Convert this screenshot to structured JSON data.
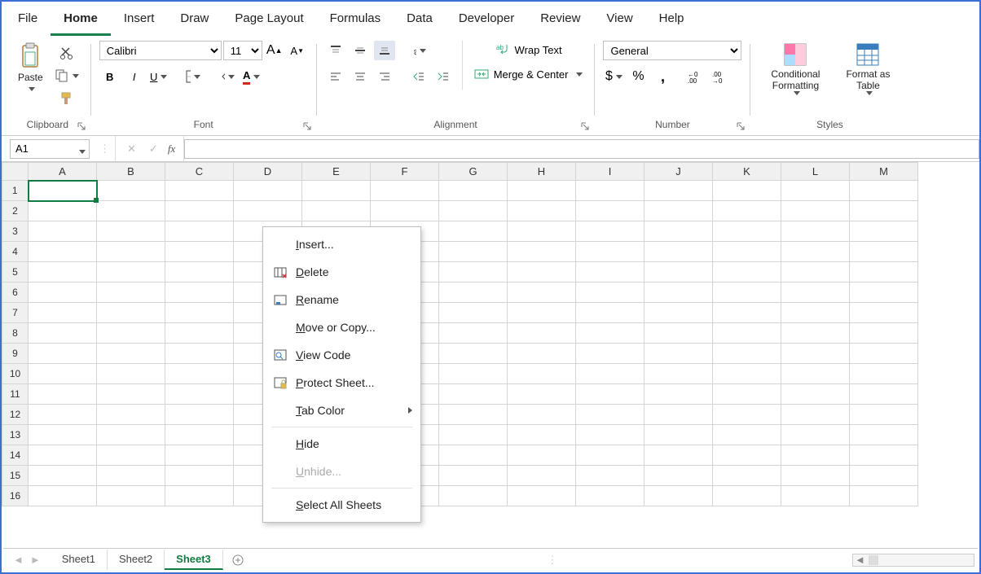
{
  "tabs": [
    "File",
    "Home",
    "Insert",
    "Draw",
    "Page Layout",
    "Formulas",
    "Data",
    "Developer",
    "Review",
    "View",
    "Help"
  ],
  "active_tab": "Home",
  "ribbon": {
    "clipboard": {
      "label": "Clipboard",
      "paste": "Paste"
    },
    "font": {
      "label": "Font",
      "name": "Calibri",
      "size": "11"
    },
    "alignment": {
      "label": "Alignment",
      "wrap": "Wrap Text",
      "merge": "Merge & Center"
    },
    "number": {
      "label": "Number",
      "format": "General"
    },
    "styles": {
      "label": "Styles",
      "cond": "Conditional Formatting",
      "table": "Format as Table"
    }
  },
  "namebox": "A1",
  "columns": [
    "A",
    "B",
    "C",
    "D",
    "E",
    "F",
    "G",
    "H",
    "I",
    "J",
    "K",
    "L",
    "M"
  ],
  "rows": [
    "1",
    "2",
    "3",
    "4",
    "5",
    "6",
    "7",
    "8",
    "9",
    "10",
    "11",
    "12",
    "13",
    "14",
    "15",
    "16"
  ],
  "sheets": [
    "Sheet1",
    "Sheet2",
    "Sheet3"
  ],
  "active_sheet": "Sheet3",
  "ctx": {
    "insert": "Insert...",
    "delete": "Delete",
    "rename": "Rename",
    "move": "Move or Copy...",
    "view": "View Code",
    "protect": "Protect Sheet...",
    "tabcolor": "Tab Color",
    "hide": "Hide",
    "unhide": "Unhide...",
    "selectall": "Select All Sheets"
  }
}
